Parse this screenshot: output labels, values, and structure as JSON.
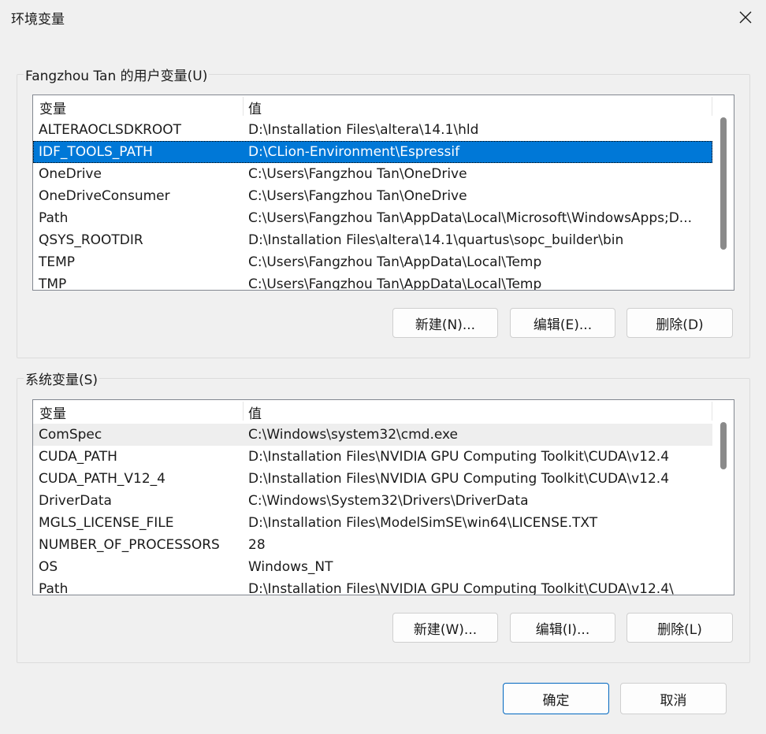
{
  "window": {
    "title": "环境变量"
  },
  "user_group": {
    "title": "Fangzhou Tan 的用户变量(U)",
    "headers": {
      "name": "变量",
      "value": "值"
    },
    "rows": [
      {
        "name": "ALTERAOCLSDKROOT",
        "value": "D:\\Installation Files\\altera\\14.1\\hld"
      },
      {
        "name": "IDF_TOOLS_PATH",
        "value": "D:\\CLion-Environment\\Espressif"
      },
      {
        "name": "OneDrive",
        "value": "C:\\Users\\Fangzhou Tan\\OneDrive"
      },
      {
        "name": "OneDriveConsumer",
        "value": "C:\\Users\\Fangzhou Tan\\OneDrive"
      },
      {
        "name": "Path",
        "value": "C:\\Users\\Fangzhou Tan\\AppData\\Local\\Microsoft\\WindowsApps;D..."
      },
      {
        "name": "QSYS_ROOTDIR",
        "value": "D:\\Installation Files\\altera\\14.1\\quartus\\sopc_builder\\bin"
      },
      {
        "name": "TEMP",
        "value": "C:\\Users\\Fangzhou Tan\\AppData\\Local\\Temp"
      },
      {
        "name": "TMP",
        "value": "C:\\Users\\Fangzhou Tan\\AppData\\Local\\Temp"
      }
    ],
    "buttons": {
      "new": "新建(N)...",
      "edit": "编辑(E)...",
      "delete": "删除(D)"
    }
  },
  "system_group": {
    "title": "系统变量(S)",
    "headers": {
      "name": "变量",
      "value": "值"
    },
    "rows": [
      {
        "name": "ComSpec",
        "value": "C:\\Windows\\system32\\cmd.exe"
      },
      {
        "name": "CUDA_PATH",
        "value": "D:\\Installation Files\\NVIDIA GPU Computing Toolkit\\CUDA\\v12.4"
      },
      {
        "name": "CUDA_PATH_V12_4",
        "value": "D:\\Installation Files\\NVIDIA GPU Computing Toolkit\\CUDA\\v12.4"
      },
      {
        "name": "DriverData",
        "value": "C:\\Windows\\System32\\Drivers\\DriverData"
      },
      {
        "name": "MGLS_LICENSE_FILE",
        "value": "D:\\Installation Files\\ModelSimSE\\win64\\LICENSE.TXT"
      },
      {
        "name": "NUMBER_OF_PROCESSORS",
        "value": "28"
      },
      {
        "name": "OS",
        "value": "Windows_NT"
      },
      {
        "name": "Path",
        "value": "D:\\Installation Files\\NVIDIA GPU Computing Toolkit\\CUDA\\v12.4\\"
      }
    ],
    "buttons": {
      "new": "新建(W)...",
      "edit": "编辑(I)...",
      "delete": "删除(L)"
    }
  },
  "footer": {
    "ok": "确定",
    "cancel": "取消"
  },
  "colors": {
    "selection": "#0078d7",
    "ok_border": "#0067c0"
  },
  "icons": {
    "close": "close-icon"
  }
}
